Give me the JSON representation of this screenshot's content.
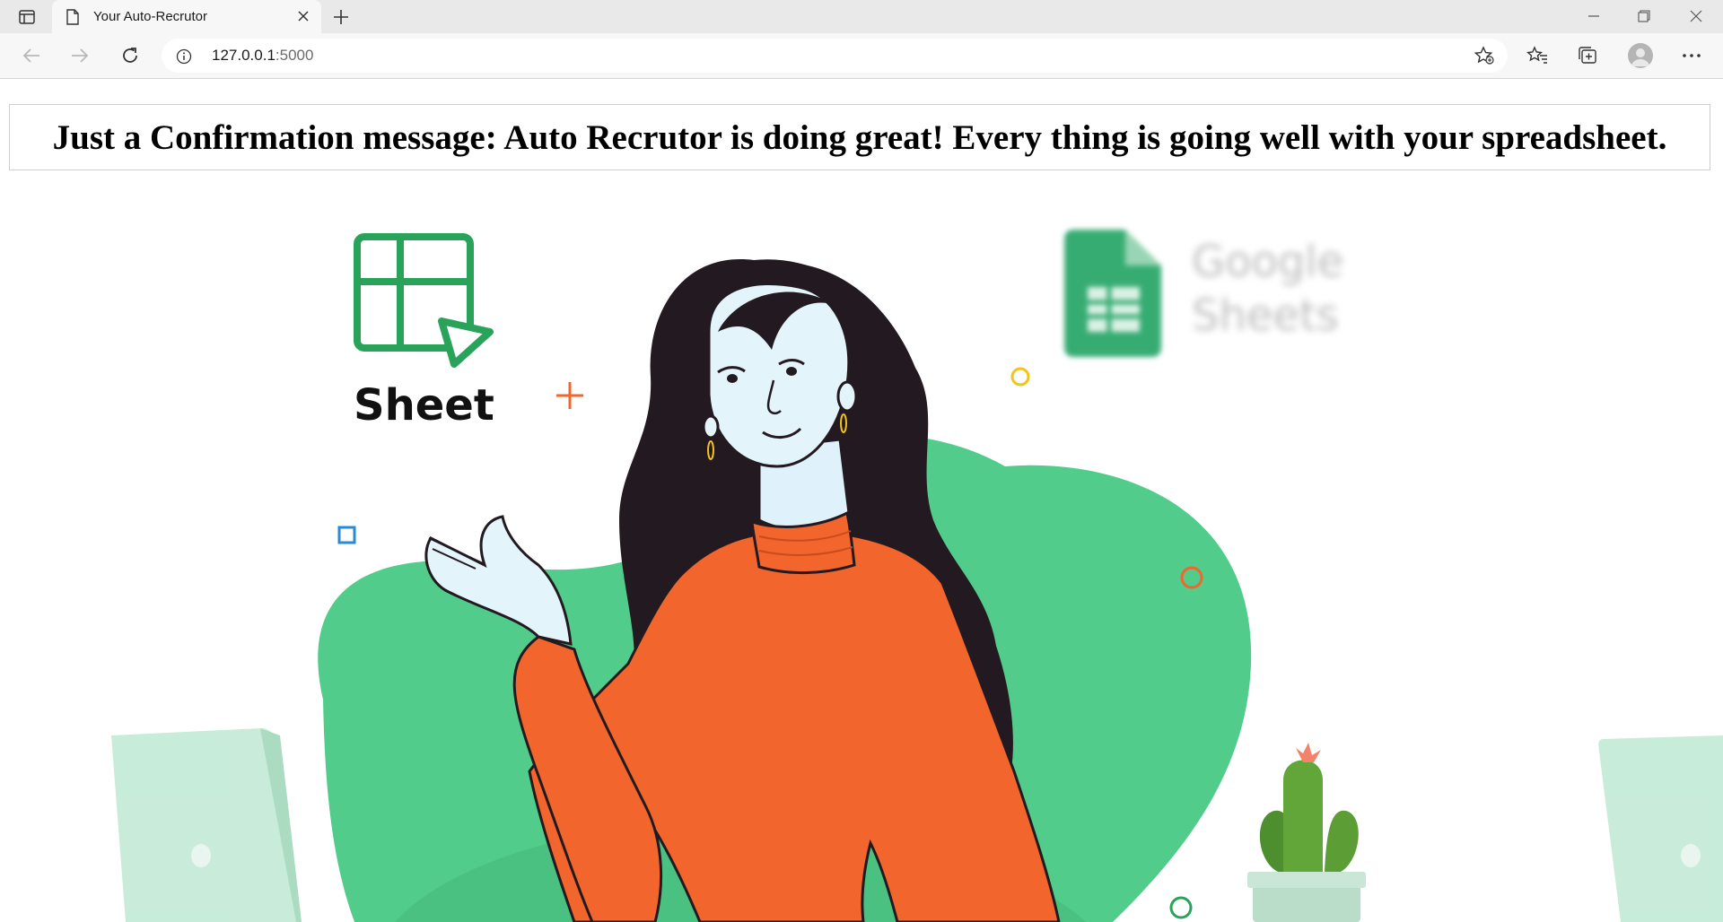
{
  "browser": {
    "tab_title": "Your Auto-Recrutor",
    "url_host": "127.0.0.1",
    "url_port": ":5000"
  },
  "page": {
    "confirmation_message": "Just a Confirmation message: Auto Recrutor is doing great! Every thing is going well with your spreadsheet."
  },
  "illustration": {
    "sheet_logo_label": "Sheet",
    "google_sheets_line1": "Google",
    "google_sheets_line2": "Sheets"
  },
  "colors": {
    "blob_green": "#52cc8a",
    "sweater_orange": "#f2652c",
    "hair": "#221a20",
    "sheet_green": "#2aa35a"
  }
}
